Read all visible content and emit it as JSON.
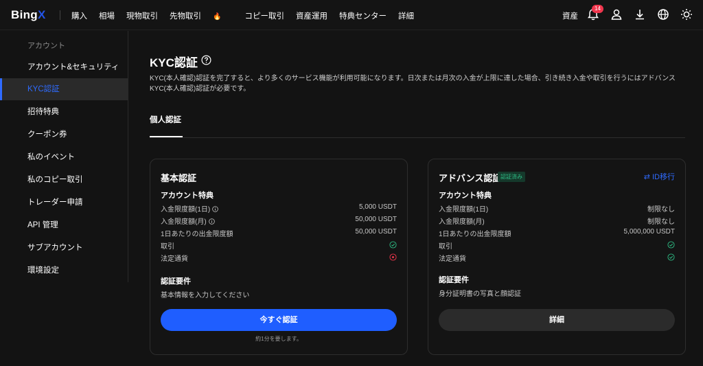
{
  "header": {
    "logo_main": "Bing",
    "logo_x": "X",
    "nav": [
      "購入",
      "相場",
      "現物取引",
      "先物取引",
      "コピー取引",
      "資産運用",
      "特典センター",
      "詳細"
    ],
    "asset_label": "資産",
    "notification_count": "14",
    "icons": [
      "bell-icon",
      "user-icon",
      "download-icon",
      "globe-icon",
      "theme-icon"
    ]
  },
  "sidebar": {
    "section_title": "アカウント",
    "items": [
      {
        "label": "アカウント&セキュリティ"
      },
      {
        "label": "KYC認証",
        "active": true
      },
      {
        "label": "招待特典"
      },
      {
        "label": "クーポン券"
      },
      {
        "label": "私のイベント"
      },
      {
        "label": "私のコピー取引"
      },
      {
        "label": "トレーダー申請"
      },
      {
        "label": "API 管理"
      },
      {
        "label": "サブアカウント"
      },
      {
        "label": "環境設定"
      }
    ]
  },
  "main": {
    "title": "KYC認証",
    "description": "KYC(本人確認)認証を完了すると、より多くのサービス機能が利用可能になります。日次または月次の入金が上限に達した場合、引き続き入金や取引を行うにはアドバンスKYC(本人確認)認証が必要です。",
    "tab": "個人認証"
  },
  "basic": {
    "title": "基本認証",
    "benefits_title": "アカウント特典",
    "rows": [
      {
        "label": "入金限度額(1日)",
        "value": "5,000 USDT"
      },
      {
        "label": "入金限度額(月)",
        "value": "50,000 USDT"
      },
      {
        "label": "1日あたりの出金限度額",
        "value": "50,000 USDT"
      },
      {
        "label": "取引",
        "value": "check"
      },
      {
        "label": "法定通貨",
        "value": "unavailable"
      }
    ],
    "req_title": "認証要件",
    "req_text": "基本情報を入力してください",
    "button": "今すぐ認証",
    "note": "約1分を要します。"
  },
  "advanced": {
    "title": "アドバンス認証",
    "badge": "認証済み",
    "migrate": "ID移行",
    "benefits_title": "アカウント特典",
    "rows": [
      {
        "label": "入金限度額(1日)",
        "value": "制限なし"
      },
      {
        "label": "入金限度額(月)",
        "value": "制限なし"
      },
      {
        "label": "1日あたりの出金限度額",
        "value": "5,000,000 USDT"
      },
      {
        "label": "取引",
        "value": "check"
      },
      {
        "label": "法定通貨",
        "value": "check"
      }
    ],
    "req_title": "認証要件",
    "req_text": "身分証明書の写真と顔認証",
    "button": "詳細"
  },
  "colors": {
    "accent": "#2f6bff",
    "success": "#2ebd85",
    "danger": "#f0364d"
  }
}
